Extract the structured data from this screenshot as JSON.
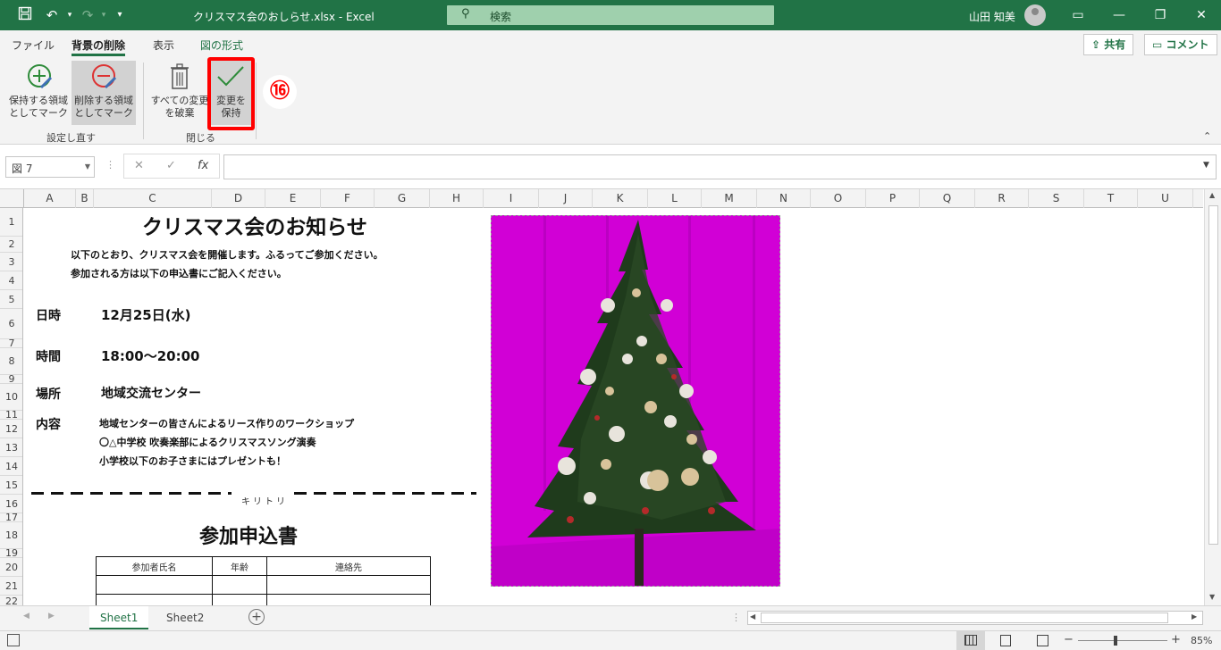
{
  "titlebar": {
    "document_title": "クリスマス会のおしらせ.xlsx  -  Excel",
    "search_placeholder": "検索",
    "user_name": "山田 知美",
    "icons": [
      "save-icon",
      "undo-icon",
      "redo-icon",
      "customize-icon",
      "search-icon",
      "ribbon-display-icon",
      "minimize-icon",
      "restore-icon",
      "close-icon"
    ]
  },
  "ribbon": {
    "tabs": [
      {
        "label": "ファイル"
      },
      {
        "label": "背景の削除"
      },
      {
        "label": "表示"
      },
      {
        "label": "図の形式"
      }
    ],
    "share_label": "共有",
    "comment_label": "コメント",
    "buttons": {
      "keep": "保持する領域\nとしてマーク",
      "remove": "削除する領域\nとしてマーク",
      "discard": "すべての変更\nを破棄",
      "keep_changes": "変更を\n保持"
    },
    "groups": {
      "refine": "設定し直す",
      "close": "閉じる"
    },
    "step_badge": "⑯"
  },
  "formulabar": {
    "name_box": "図 7",
    "formula": ""
  },
  "columns": [
    "A",
    "B",
    "C",
    "D",
    "E",
    "F",
    "G",
    "H",
    "I",
    "J",
    "K",
    "L",
    "M",
    "N",
    "O",
    "P",
    "Q",
    "R",
    "S",
    "T",
    "U"
  ],
  "rows": [
    "1",
    "2",
    "3",
    "4",
    "5",
    "6",
    "7",
    "8",
    "9",
    "10",
    "11",
    "12",
    "13",
    "14",
    "15",
    "16",
    "17",
    "18",
    "19",
    "20",
    "21",
    "22"
  ],
  "sheet": {
    "title": "クリスマス会のお知らせ",
    "intro_line1": "以下のとおり、クリスマス会を開催します。ふるってご参加ください。",
    "intro_line2": "参加される方は以下の申込書にご記入ください。",
    "date_label": "日時",
    "date_value": "12月25日(水)",
    "time_label": "時間",
    "time_value": "18:00～20:00",
    "place_label": "場所",
    "place_value": "地域交流センター",
    "content_label": "内容",
    "content_line1": "地域センターの皆さんによるリース作りのワークショップ",
    "content_line2": "〇△中学校 吹奏楽部によるクリスマスソング演奏",
    "content_line3": "小学校以下のお子さまにはプレゼントも！",
    "cut_line": "キリトリ",
    "form_title": "参加申込書",
    "table_headers": [
      "参加者氏名",
      "年齢",
      "連絡先"
    ]
  },
  "sheet_tabs": [
    "Sheet1",
    "Sheet2"
  ],
  "status": {
    "zoom": "85%",
    "colors": {
      "accent": "#217346",
      "highlight": "#ff0000",
      "bg_removal": "#d100d6"
    }
  }
}
